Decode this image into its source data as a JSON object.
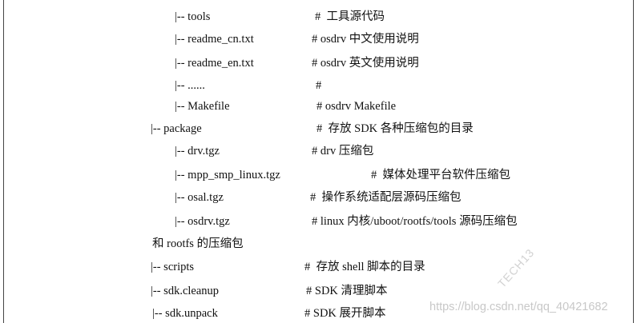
{
  "lines": [
    {
      "tree": "|-- tools",
      "comment": "#  工具源代码"
    },
    {
      "tree": "|-- readme_cn.txt",
      "comment": "# osdrv 中文使用说明"
    },
    {
      "tree": "|-- readme_en.txt",
      "comment": "# osdrv 英文使用说明"
    },
    {
      "tree": "|-- ......",
      "comment": "#"
    },
    {
      "tree": "|-- Makefile",
      "comment": "# osdrv Makefile"
    },
    {
      "tree": "|-- package",
      "comment": "#  存放 SDK 各种压缩包的目录"
    },
    {
      "tree": "|-- drv.tgz",
      "comment": "# drv 压缩包"
    },
    {
      "tree": "|-- mpp_smp_linux.tgz",
      "comment": "#  媒体处理平台软件压缩包"
    },
    {
      "tree": "|-- osal.tgz",
      "comment": "#  操作系统适配层源码压缩包"
    },
    {
      "tree": "|-- osdrv.tgz",
      "comment": "# linux 内核/uboot/rootfs/tools 源码压缩包"
    },
    {
      "tree": "和 rootfs 的压缩包",
      "comment": ""
    },
    {
      "tree": "|-- scripts",
      "comment": "#  存放 shell 脚本的目录"
    },
    {
      "tree": "|-- sdk.cleanup",
      "comment": "# SDK 清理脚本"
    },
    {
      "tree": "|-- sdk.unpack",
      "comment": "# SDK 展开脚本"
    }
  ],
  "watermark": "https://blog.csdn.net/qq_40421682",
  "stamp": "TECH13"
}
